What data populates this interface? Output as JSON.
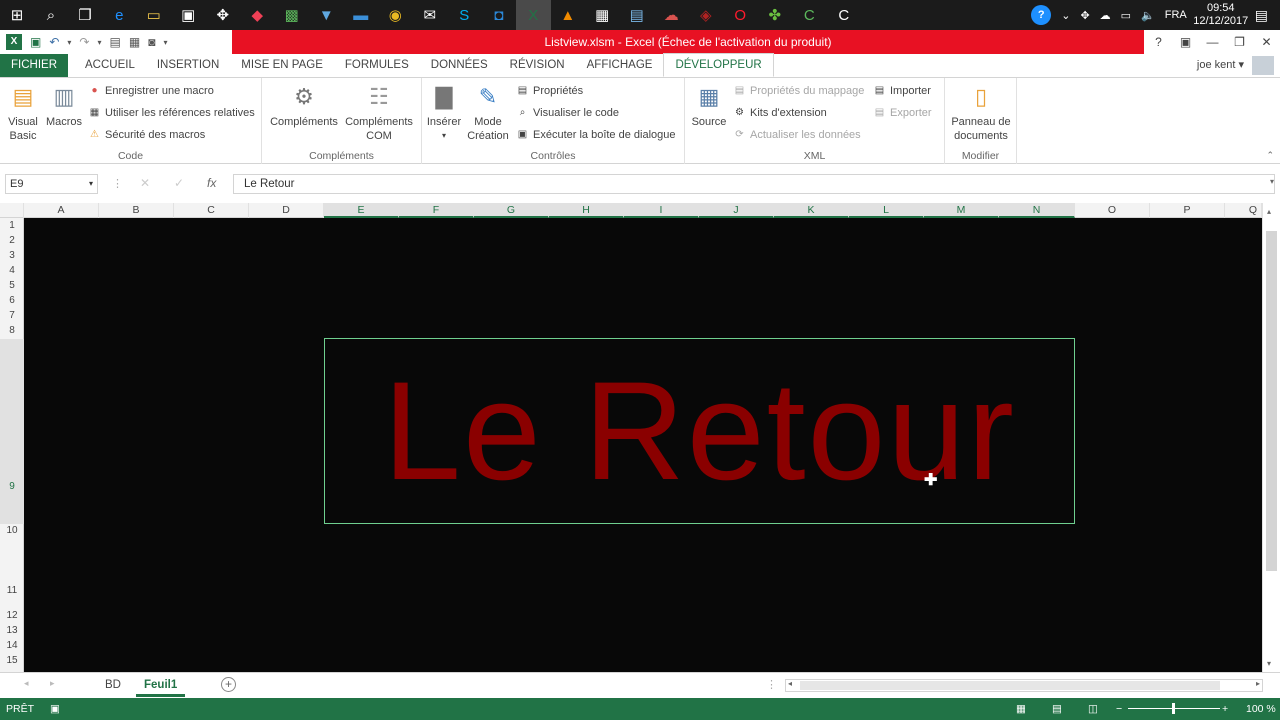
{
  "taskbar": {
    "apps": [
      {
        "icon": "windows-start-icon",
        "color": "#ffffff"
      },
      {
        "icon": "search-icon",
        "color": "#ffffff"
      },
      {
        "icon": "task-view-icon",
        "color": "#ffffff"
      },
      {
        "icon": "edge-icon",
        "color": "#1e90ff"
      },
      {
        "icon": "file-explorer-icon",
        "color": "#f2c94c"
      },
      {
        "icon": "store-icon",
        "color": "#ffffff"
      },
      {
        "icon": "dropbox-icon",
        "color": "#ffffff"
      },
      {
        "icon": "pocket-icon",
        "color": "#ef4056"
      },
      {
        "icon": "green-app-icon",
        "color": "#5cb85c"
      },
      {
        "icon": "filter-icon",
        "color": "#5fa8e0"
      },
      {
        "icon": "app-blue-icon",
        "color": "#3b8fd8"
      },
      {
        "icon": "chrome-icon",
        "color": "#e8b923"
      },
      {
        "icon": "mail-icon",
        "color": "#ffffff"
      },
      {
        "icon": "skype-icon",
        "color": "#00aff0"
      },
      {
        "icon": "app-sync-icon",
        "color": "#2b88d8"
      },
      {
        "icon": "excel-icon",
        "color": "#217346"
      },
      {
        "icon": "vlc-icon",
        "color": "#f08a00"
      },
      {
        "icon": "calculator-icon",
        "color": "#ffffff"
      },
      {
        "icon": "notepad-icon",
        "color": "#7ab8e8"
      },
      {
        "icon": "cloud-app-icon",
        "color": "#d9534f"
      },
      {
        "icon": "red-app-icon",
        "color": "#b22222"
      },
      {
        "icon": "opera-icon",
        "color": "#ff1b2d"
      },
      {
        "icon": "clover-icon",
        "color": "#6abf40"
      },
      {
        "icon": "camtasia-icon",
        "color": "#5cb85c"
      },
      {
        "icon": "c-app-icon",
        "color": "#ffffff"
      }
    ],
    "tray_lang": "FRA",
    "time": "09:54",
    "date": "12/12/2017"
  },
  "titlebar": {
    "title": "Listview.xlsm -  Excel (Échec de l'activation du produit)",
    "help": "?"
  },
  "tabs": [
    "FICHIER",
    "ACCUEIL",
    "INSERTION",
    "MISE EN PAGE",
    "FORMULES",
    "DONNÉES",
    "RÉVISION",
    "AFFICHAGE",
    "DÉVELOPPEUR"
  ],
  "user": "joe kent",
  "ribbon": {
    "code": {
      "label": "Code",
      "visual_basic": "Visual Basic",
      "macros": "Macros",
      "record": "Enregistrer une macro",
      "relative": "Utiliser les références relatives",
      "security": "Sécurité des macros"
    },
    "complements": {
      "label": "Compléments",
      "complements": "Compléments",
      "com": "Compléments COM"
    },
    "controles": {
      "label": "Contrôles",
      "inserer": "Insérer",
      "mode": "Mode Création",
      "proprietes": "Propriétés",
      "visualiser": "Visualiser le code",
      "executer": "Exécuter la boîte de dialogue"
    },
    "xml": {
      "label": "XML",
      "source": "Source",
      "mapping": "Propriétés du mappage",
      "kits": "Kits d'extension",
      "actualiser": "Actualiser les données",
      "importer": "Importer",
      "exporter": "Exporter"
    },
    "modifier": {
      "label": "Modifier",
      "panneau": "Panneau de documents"
    }
  },
  "formula": {
    "namebox": "E9",
    "fx": "fx",
    "content": "Le Retour"
  },
  "columns": [
    "A",
    "B",
    "C",
    "D",
    "E",
    "F",
    "G",
    "H",
    "I",
    "J",
    "K",
    "L",
    "M",
    "N",
    "O",
    "P",
    "Q"
  ],
  "rows": [
    "1",
    "2",
    "3",
    "4",
    "5",
    "6",
    "7",
    "8",
    "9",
    "10",
    "11",
    "12",
    "13",
    "14",
    "15"
  ],
  "shape_text": "Le Retour",
  "sheets": [
    "BD",
    "Feuil1"
  ],
  "status": {
    "ready": "PRÊT",
    "zoom": "100 %"
  },
  "colors": {
    "excel_green": "#217346",
    "title_red": "#e81123",
    "shape_text": "#8a0000",
    "grid_bg": "#080808"
  }
}
